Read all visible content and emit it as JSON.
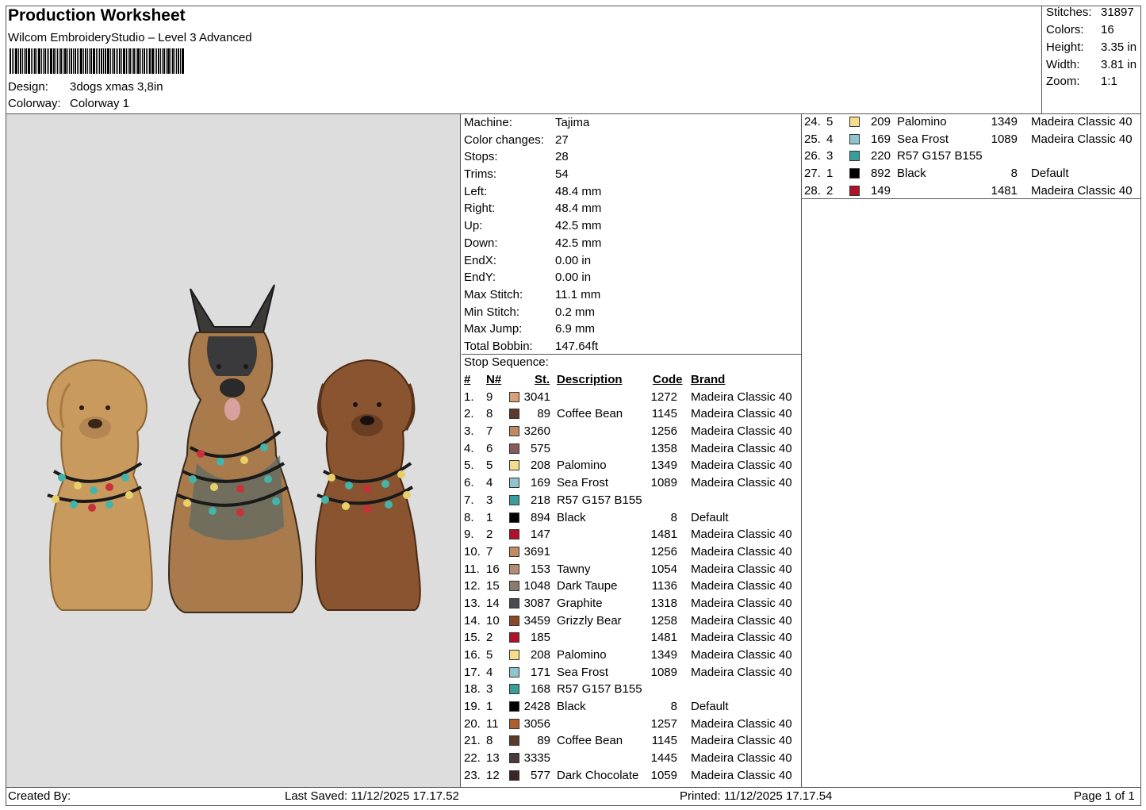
{
  "header": {
    "title": "Production Worksheet",
    "software": "Wilcom EmbroideryStudio – Level 3 Advanced",
    "design_label": "Design:",
    "design_value": "3dogs xmas 3,8in",
    "colorway_label": "Colorway:",
    "colorway_value": "Colorway 1"
  },
  "stats": [
    {
      "label": "Stitches:",
      "value": "31897"
    },
    {
      "label": "Colors:",
      "value": "16"
    },
    {
      "label": "Height:",
      "value": "3.35 in"
    },
    {
      "label": "Width:",
      "value": "3.81 in"
    },
    {
      "label": "Zoom:",
      "value": "1:1"
    }
  ],
  "machine_info": [
    {
      "label": "Machine:",
      "value": "Tajima"
    },
    {
      "label": "Color changes:",
      "value": "27"
    },
    {
      "label": "Stops:",
      "value": "28"
    },
    {
      "label": "Trims:",
      "value": "54"
    },
    {
      "label": "Left:",
      "value": "48.4 mm"
    },
    {
      "label": "Right:",
      "value": "48.4 mm"
    },
    {
      "label": "Up:",
      "value": "42.5 mm"
    },
    {
      "label": "Down:",
      "value": "42.5 mm"
    },
    {
      "label": "EndX:",
      "value": "0.00 in"
    },
    {
      "label": "EndY:",
      "value": "0.00 in"
    },
    {
      "label": "Max Stitch:",
      "value": "11.1 mm"
    },
    {
      "label": "Min Stitch:",
      "value": "0.2 mm"
    },
    {
      "label": "Max Jump:",
      "value": "6.9 mm"
    },
    {
      "label": "Total Bobbin:",
      "value": "147.64ft"
    }
  ],
  "stop_sequence": {
    "title": "Stop Sequence:",
    "headers": {
      "idx": "#",
      "n": "N#",
      "st": "St.",
      "desc": "Description",
      "code": "Code",
      "brand": "Brand"
    },
    "rows": [
      {
        "idx": "1.",
        "n": "9",
        "color": "#d9a07a",
        "st": "3041",
        "desc": "",
        "code": "1272",
        "brand": "Madeira Classic 40"
      },
      {
        "idx": "2.",
        "n": "8",
        "color": "#5a3a2a",
        "st": "89",
        "desc": "Coffee Bean",
        "code": "1145",
        "brand": "Madeira Classic 40"
      },
      {
        "idx": "3.",
        "n": "7",
        "color": "#c08a62",
        "st": "3260",
        "desc": "",
        "code": "1256",
        "brand": "Madeira Classic 40"
      },
      {
        "idx": "4.",
        "n": "6",
        "color": "#8a5a5a",
        "st": "575",
        "desc": "",
        "code": "1358",
        "brand": "Madeira Classic 40"
      },
      {
        "idx": "5.",
        "n": "5",
        "color": "#f7dc8c",
        "st": "208",
        "desc": "Palomino",
        "code": "1349",
        "brand": "Madeira Classic 40"
      },
      {
        "idx": "6.",
        "n": "4",
        "color": "#8fc4cf",
        "st": "169",
        "desc": "Sea Frost",
        "code": "1089",
        "brand": "Madeira Classic 40"
      },
      {
        "idx": "7.",
        "n": "3",
        "color": "#399d9b",
        "st": "218",
        "desc": "R57 G157 B155",
        "code": "",
        "brand": ""
      },
      {
        "idx": "8.",
        "n": "1",
        "color": "#000000",
        "st": "894",
        "desc": "Black",
        "code": "8",
        "brand": "Default"
      },
      {
        "idx": "9.",
        "n": "2",
        "color": "#b0102a",
        "st": "147",
        "desc": "",
        "code": "1481",
        "brand": "Madeira Classic 40"
      },
      {
        "idx": "10.",
        "n": "7",
        "color": "#c08a62",
        "st": "3691",
        "desc": "",
        "code": "1256",
        "brand": "Madeira Classic 40"
      },
      {
        "idx": "11.",
        "n": "16",
        "color": "#b38c72",
        "st": "153",
        "desc": "Tawny",
        "code": "1054",
        "brand": "Madeira Classic 40"
      },
      {
        "idx": "12.",
        "n": "15",
        "color": "#8c7a6a",
        "st": "1048",
        "desc": "Dark Taupe",
        "code": "1136",
        "brand": "Madeira Classic 40"
      },
      {
        "idx": "13.",
        "n": "14",
        "color": "#4a4a52",
        "st": "3087",
        "desc": "Graphite",
        "code": "1318",
        "brand": "Madeira Classic 40"
      },
      {
        "idx": "14.",
        "n": "10",
        "color": "#8a4a28",
        "st": "3459",
        "desc": "Grizzly Bear",
        "code": "1258",
        "brand": "Madeira Classic 40"
      },
      {
        "idx": "15.",
        "n": "2",
        "color": "#b0102a",
        "st": "185",
        "desc": "",
        "code": "1481",
        "brand": "Madeira Classic 40"
      },
      {
        "idx": "16.",
        "n": "5",
        "color": "#f7dc8c",
        "st": "208",
        "desc": "Palomino",
        "code": "1349",
        "brand": "Madeira Classic 40"
      },
      {
        "idx": "17.",
        "n": "4",
        "color": "#8fc4cf",
        "st": "171",
        "desc": "Sea Frost",
        "code": "1089",
        "brand": "Madeira Classic 40"
      },
      {
        "idx": "18.",
        "n": "3",
        "color": "#399d9b",
        "st": "168",
        "desc": "R57 G157 B155",
        "code": "",
        "brand": ""
      },
      {
        "idx": "19.",
        "n": "1",
        "color": "#000000",
        "st": "2428",
        "desc": "Black",
        "code": "8",
        "brand": "Default"
      },
      {
        "idx": "20.",
        "n": "11",
        "color": "#b0602e",
        "st": "3056",
        "desc": "",
        "code": "1257",
        "brand": "Madeira Classic 40"
      },
      {
        "idx": "21.",
        "n": "8",
        "color": "#5a3a2a",
        "st": "89",
        "desc": "Coffee Bean",
        "code": "1145",
        "brand": "Madeira Classic 40"
      },
      {
        "idx": "22.",
        "n": "13",
        "color": "#4a3a3a",
        "st": "3335",
        "desc": "",
        "code": "1445",
        "brand": "Madeira Classic 40"
      },
      {
        "idx": "23.",
        "n": "12",
        "color": "#3a2626",
        "st": "577",
        "desc": "Dark Chocolate",
        "code": "1059",
        "brand": "Madeira Classic 40"
      }
    ],
    "rows_right": [
      {
        "idx": "24.",
        "n": "5",
        "color": "#f7dc8c",
        "st": "209",
        "desc": "Palomino",
        "code": "1349",
        "brand": "Madeira Classic 40"
      },
      {
        "idx": "25.",
        "n": "4",
        "color": "#8fc4cf",
        "st": "169",
        "desc": "Sea Frost",
        "code": "1089",
        "brand": "Madeira Classic 40"
      },
      {
        "idx": "26.",
        "n": "3",
        "color": "#399d9b",
        "st": "220",
        "desc": "R57 G157 B155",
        "code": "",
        "brand": ""
      },
      {
        "idx": "27.",
        "n": "1",
        "color": "#000000",
        "st": "892",
        "desc": "Black",
        "code": "8",
        "brand": "Default"
      },
      {
        "idx": "28.",
        "n": "2",
        "color": "#b0102a",
        "st": "149",
        "desc": "",
        "code": "1481",
        "brand": "Madeira Classic 40"
      }
    ]
  },
  "footer": {
    "created_by": "Created By:",
    "last_saved": "Last Saved: 11/12/2025 17.17.52",
    "printed": "Printed: 11/12/2025 17.17.54",
    "page": "Page 1 of 1"
  }
}
